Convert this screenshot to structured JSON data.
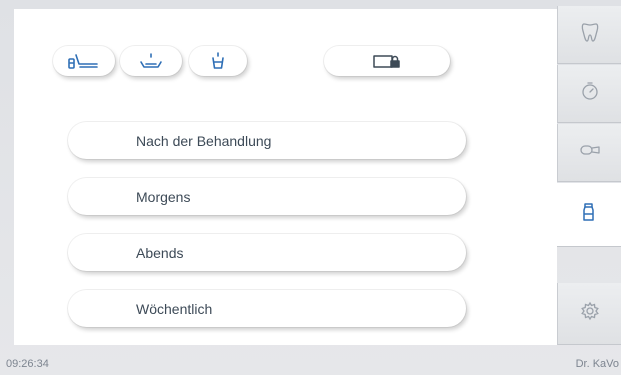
{
  "toolbar": {
    "icons": [
      "dental-chair-icon",
      "basin-rinse-icon",
      "cup-filler-icon",
      "locked-screen-icon"
    ]
  },
  "menu": {
    "items": [
      {
        "label": "Nach der Behandlung"
      },
      {
        "label": "Morgens"
      },
      {
        "label": "Abends"
      },
      {
        "label": "Wöchentlich"
      }
    ]
  },
  "sidebar": {
    "items": [
      {
        "icon": "tooth-icon"
      },
      {
        "icon": "timer-icon"
      },
      {
        "icon": "camera-icon"
      },
      {
        "icon": "hygiene-bottle-icon",
        "active": true
      },
      {
        "icon": "settings-gear-icon"
      }
    ]
  },
  "status": {
    "time": "09:26:34",
    "user": "Dr. KaVo"
  },
  "colors": {
    "accent": "#2f6fb6",
    "text": "#3d4a57",
    "icon_grey": "#9aa1aa"
  }
}
